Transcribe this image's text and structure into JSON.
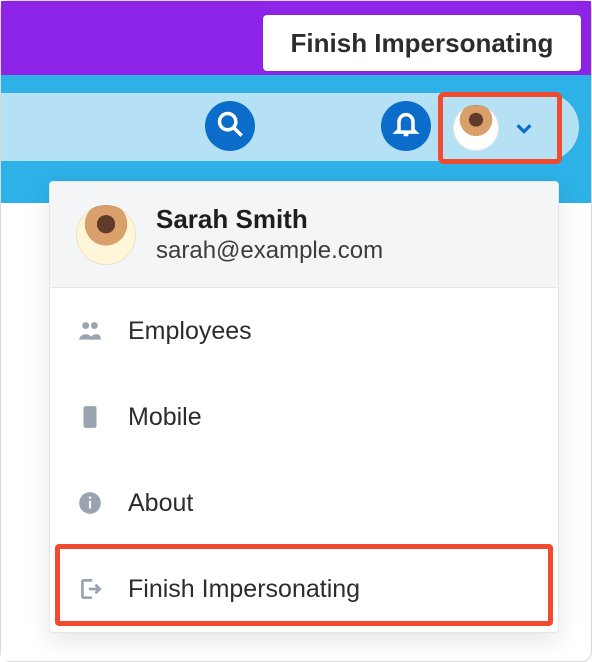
{
  "banner": {
    "finish_label": "Finish Impersonating"
  },
  "toolbar": {
    "search_icon": "search-icon",
    "bell_icon": "bell-icon",
    "avatar_icon": "avatar-icon",
    "chevron_icon": "chevron-down-icon"
  },
  "dropdown": {
    "user": {
      "name": "Sarah Smith",
      "email": "sarah@example.com"
    },
    "items": [
      {
        "icon": "employees-icon",
        "label": "Employees"
      },
      {
        "icon": "mobile-icon",
        "label": "Mobile"
      },
      {
        "icon": "about-icon",
        "label": "About"
      },
      {
        "icon": "exit-icon",
        "label": "Finish Impersonating"
      }
    ]
  },
  "colors": {
    "purple": "#8d24e8",
    "blue": "#2db1e6",
    "light_blue": "#b6e1f4",
    "primary_blue": "#0b6dc9",
    "highlight": "#f04b2f",
    "icon_gray": "#9aa3b0"
  }
}
